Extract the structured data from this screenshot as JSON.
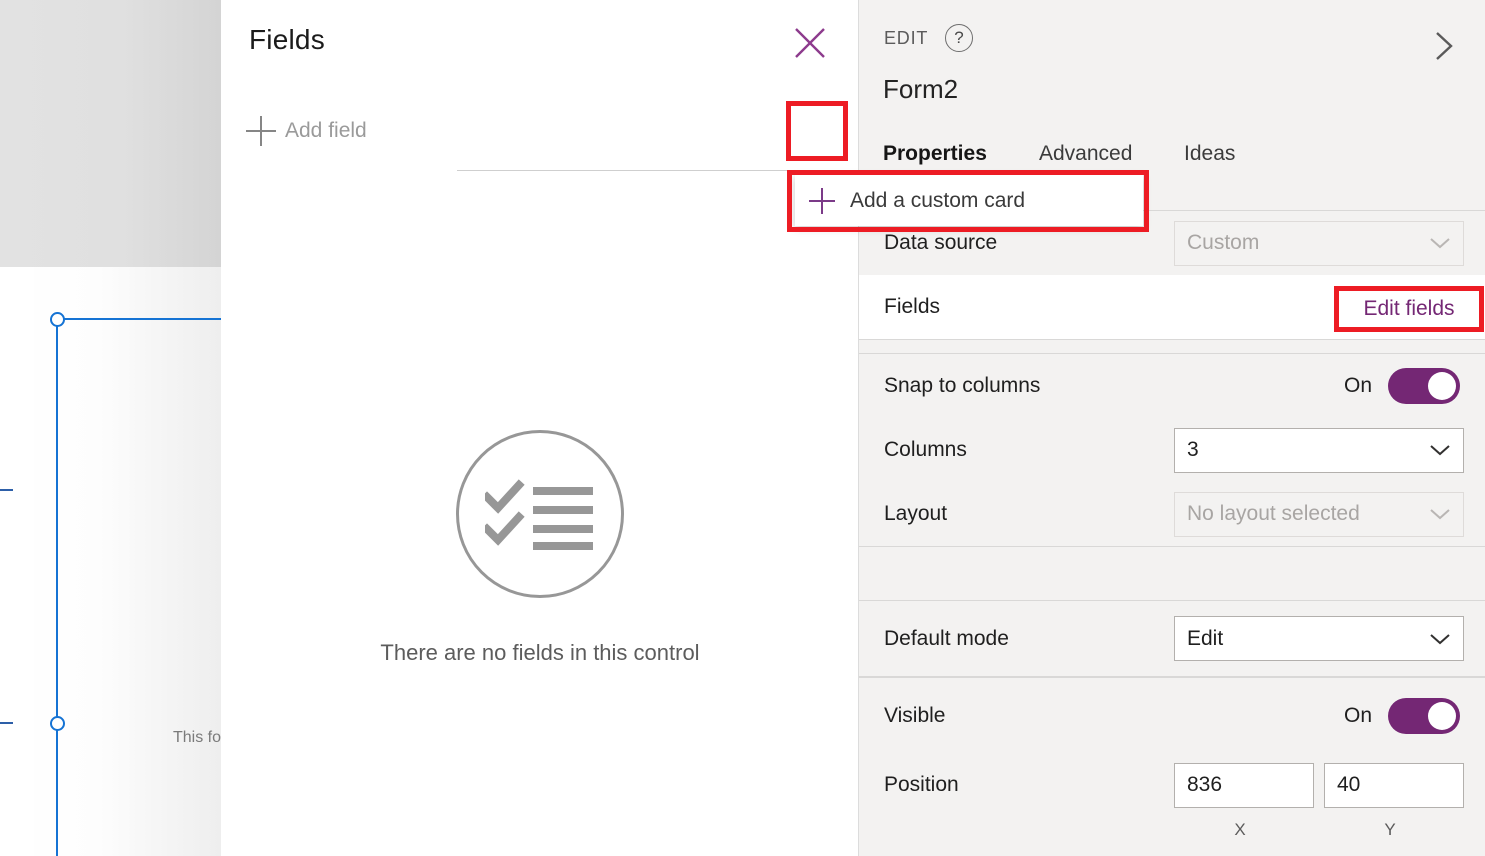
{
  "canvas": {
    "note_text": "This fo"
  },
  "fields_panel": {
    "title": "Fields",
    "close_icon": "close-icon",
    "add_field_label": "Add field",
    "more_button_glyph": "•••",
    "empty_state": {
      "icon": "checklist-circle-icon",
      "message": "There are no fields in this control"
    }
  },
  "context_menu": {
    "items": [
      {
        "label": "Add a custom card",
        "icon": "plus-icon"
      }
    ]
  },
  "properties_panel": {
    "edit_label": "EDIT",
    "help_icon": "?",
    "collapse_icon": "chevron-right-icon",
    "object_name": "Form2",
    "tabs": [
      {
        "label": "Properties",
        "active": true
      },
      {
        "label": "Advanced",
        "active": false
      },
      {
        "label": "Ideas",
        "active": false
      }
    ],
    "rows": {
      "data_source": {
        "label": "Data source",
        "value": "Custom",
        "disabled": true
      },
      "fields": {
        "label": "Fields",
        "action_label": "Edit fields"
      },
      "snap_to_columns": {
        "label": "Snap to columns",
        "state": "On"
      },
      "columns": {
        "label": "Columns",
        "value": "3"
      },
      "layout": {
        "label": "Layout",
        "value": "No layout selected",
        "disabled": true
      },
      "default_mode": {
        "label": "Default mode",
        "value": "Edit"
      },
      "visible": {
        "label": "Visible",
        "state": "On"
      },
      "position": {
        "label": "Position",
        "x_value": "836",
        "y_value": "40",
        "x_axis_label": "X",
        "y_axis_label": "Y"
      }
    }
  },
  "colors": {
    "accent_purple": "#742774",
    "annotation_red": "#ed1c24",
    "selection_blue": "#1573d4",
    "panel_bg": "#f3f2f1"
  }
}
